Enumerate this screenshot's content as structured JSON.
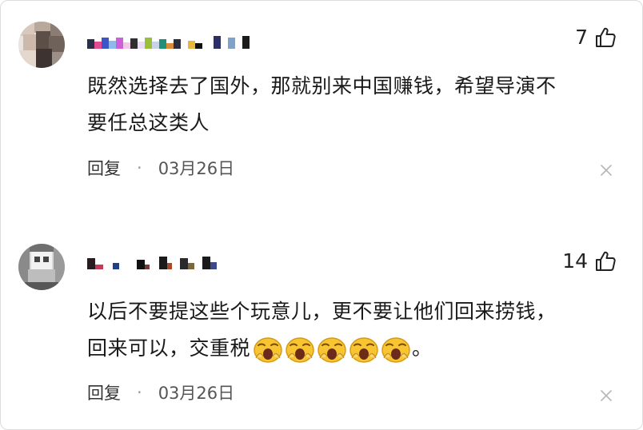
{
  "comments": [
    {
      "like_count": "7",
      "text_lines": [
        "既然选择去了国外，那就别来中国赚钱，希望导演不",
        "要任总这类人"
      ],
      "reply_label": "回复",
      "separator": "·",
      "date": "03月26日",
      "like_icon": "thumbs-up-icon",
      "close_icon": "close-icon"
    },
    {
      "like_count": "14",
      "text_lines": [
        "以后不要提这些个玩意儿，更不要让他们回来捞钱，",
        "回来可以，交重税"
      ],
      "trailing_text": "。",
      "emoji": [
        "yawning-face-emoji",
        "yawning-face-emoji",
        "yawning-face-emoji",
        "yawning-face-emoji",
        "yawning-face-emoji"
      ],
      "reply_label": "回复",
      "separator": "·",
      "date": "03月26日",
      "like_icon": "thumbs-up-icon",
      "close_icon": "close-icon"
    }
  ],
  "colors": {
    "text": "#1a1a1a",
    "meta": "#555555",
    "border": "#dcdcdc"
  }
}
